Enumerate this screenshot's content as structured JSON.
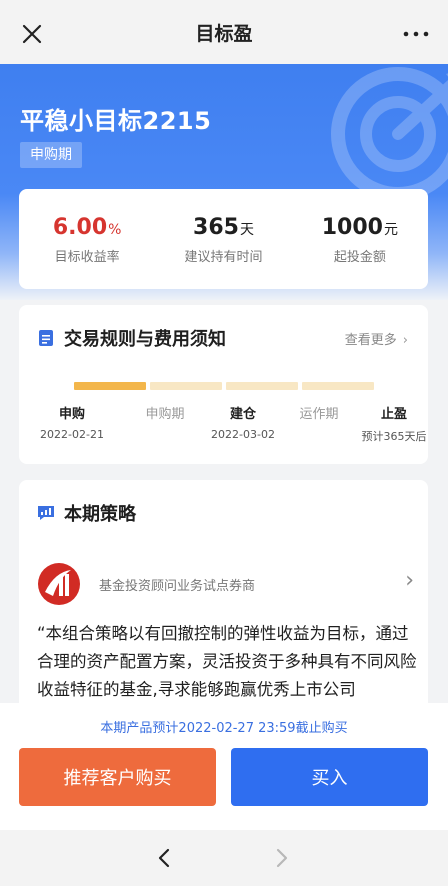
{
  "topbar": {
    "title": "目标盈"
  },
  "hero": {
    "product_name": "平稳小目标2215",
    "phase_badge": "申购期"
  },
  "stats": [
    {
      "value": "6.00",
      "unit": "%",
      "label": "目标收益率"
    },
    {
      "value": "365",
      "unit": "天",
      "label": "建议持有时间"
    },
    {
      "value": "1000",
      "unit": "元",
      "label": "起投金额"
    }
  ],
  "rules": {
    "title": "交易规则与费用须知",
    "more": "查看更多",
    "progress_active_segments": 1,
    "progress_total_segments": 4,
    "steps": [
      {
        "name": "申购",
        "date": "2022-02-21"
      },
      {
        "name": "申购期",
        "date": ""
      },
      {
        "name": "建仓",
        "date": "2022-03-02"
      },
      {
        "name": "运作期",
        "date": ""
      },
      {
        "name": "止盈",
        "date": "预计365天后"
      }
    ]
  },
  "strategy": {
    "title": "本期策略",
    "fund_name": "基金投资顾问业务试点券商",
    "description": "“本组合策略以有回撤控制的弹性收益为目标，通过合理的资产配置方案，灵活投资于多种具有不同风险收益特征的基金,寻求能够跑赢优秀上市公司"
  },
  "bottom": {
    "notice": "本期产品预计2022-02-27 23:59截止购买",
    "recommend_label": "推荐客户购买",
    "buy_label": "买入"
  },
  "colors": {
    "accent_blue": "#2f6ef0",
    "accent_orange": "#ee6b3d",
    "rate_red": "#d6352f",
    "progress_gold": "#f3b64b"
  }
}
